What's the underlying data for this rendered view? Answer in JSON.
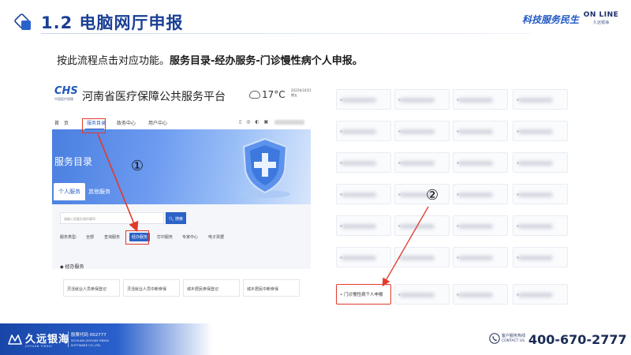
{
  "header": {
    "title": "1.2 电脑网厅申报",
    "slogan": "科技服务民生",
    "brand_big": "ON LINE",
    "brand_small": "久远银海"
  },
  "instruction": {
    "prefix": "按此流程点击对应功能。",
    "path": "服务目录-经办服务-门诊慢性病个人申报。"
  },
  "left_screenshot": {
    "logo": "CHS",
    "logo_sub": "中国医疗保障",
    "site_name": "河南省医疗保障公共服务平台",
    "weather": {
      "temp": "17°C",
      "date": "2022年10月14日 星期五"
    },
    "nav": [
      "首　页",
      "服务目录",
      "政务中心",
      "用户中心"
    ],
    "nav_icons": "▯ ◎ ◐ ▣",
    "banner_title": "服务目录",
    "tabs": [
      "个人服务",
      "其他服务"
    ],
    "search_placeholder": "请输入您要办理的事项",
    "search_button": "搜索",
    "type_label": "服务类型:",
    "type_options": [
      "全部",
      "查询服务",
      "经办服务",
      "打印服务",
      "专家中心",
      "电子票据"
    ],
    "section_title": "经办服务",
    "cards": [
      "灵活就业人员参保登记",
      "灵活就业人员中断参保",
      "城乡居民参保登记",
      "城乡居民中断参保"
    ]
  },
  "annotations": {
    "marker1": "①",
    "marker2": "②"
  },
  "right_screenshot": {
    "selected_item": "门诊慢性病个人申报"
  },
  "footer": {
    "brand": "久远银海",
    "brand_en": "JIUYUAN YINHAI",
    "stock_code": "股票代码 002777",
    "company_en_1": "SICHUAN JIUYUAN YINHAI",
    "company_en_2": "SOFTWARE CO.,LTD.",
    "hotline_label": "客户服务热线",
    "hotline_en": "CONTACT US",
    "hotline_number": "400-670-2777"
  }
}
